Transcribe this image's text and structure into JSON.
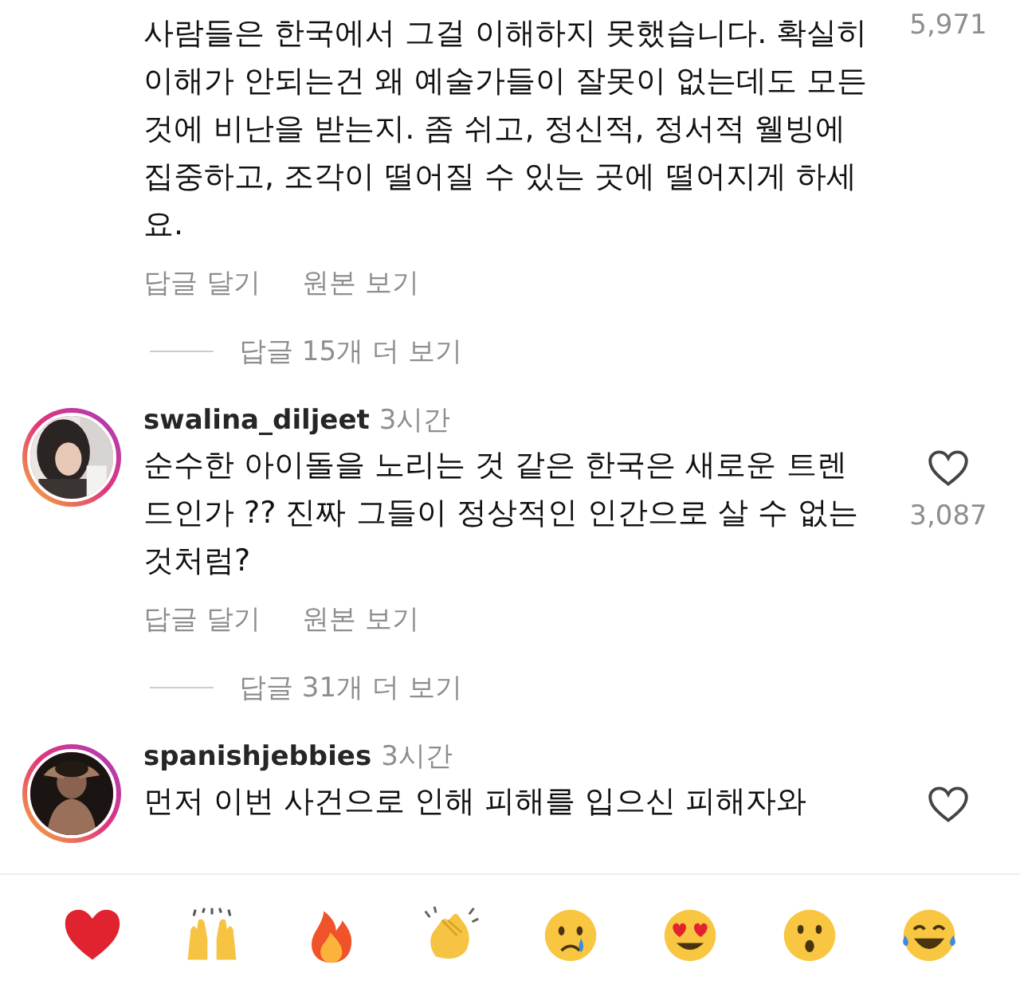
{
  "comments": [
    {
      "text": "사람들은 한국에서 그걸 이해하지 못했습니다. 확실히 이해가 안되는건 왜 예술가들이 잘못이 없는데도 모든 것에 비난을 받는지. 좀 쉬고, 정신적, 정서적 웰빙에 집중하고, 조각이 떨어질 수 있는 곳에 떨어지게 하세요.",
      "likes": "5,971",
      "actions": [
        "답글 달기",
        "원본 보기"
      ],
      "more_replies": "답글 15개 더 보기"
    },
    {
      "username": "swalina_diljeet",
      "time": "3시간",
      "text": "순수한 아이돌을 노리는 것 같은 한국은 새로운 트렌드인가 ?? 진짜 그들이 정상적인 인간으로 살 수 없는 것처럼?",
      "likes": "3,087",
      "actions": [
        "답글 달기",
        "원본 보기"
      ],
      "more_replies": "답글 31개 더 보기"
    },
    {
      "username": "spanishjebbies",
      "time": "3시간",
      "text": "먼저 이번 사건으로 인해 피해를 입으신 피해자와"
    }
  ],
  "reactions": [
    {
      "kind": "heart"
    },
    {
      "kind": "raised-hands"
    },
    {
      "kind": "fire"
    },
    {
      "kind": "clap"
    },
    {
      "kind": "crying"
    },
    {
      "kind": "heart-eyes"
    },
    {
      "kind": "surprised"
    },
    {
      "kind": "laughing"
    }
  ]
}
